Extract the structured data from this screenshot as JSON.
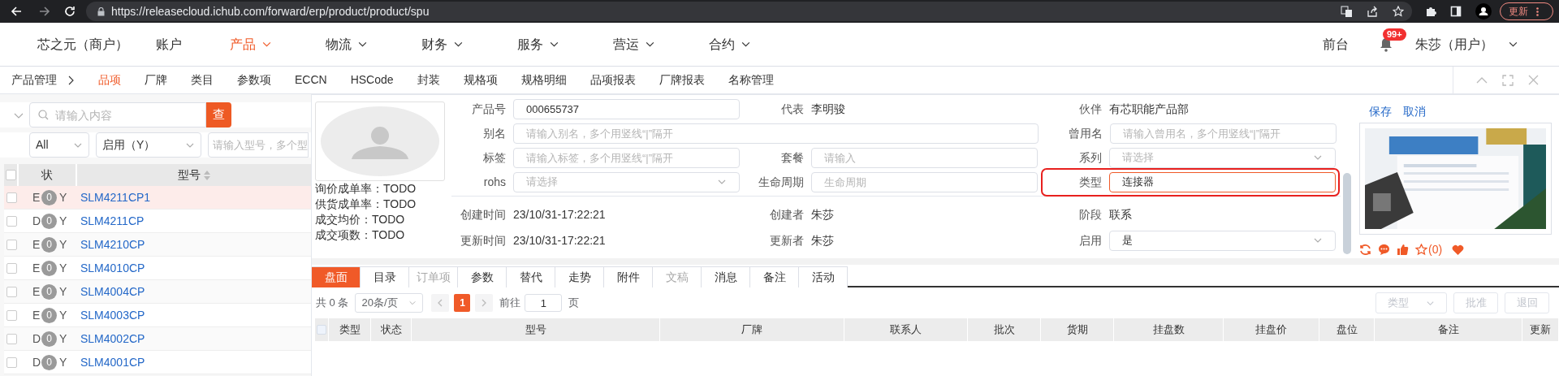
{
  "browser": {
    "url": "https://releasecloud.ichub.com/forward/erp/product/product/spu",
    "update_button": "更新"
  },
  "nav": {
    "brand": "芯之元（商户）",
    "items": [
      {
        "label": "账户",
        "dropdown": false,
        "selected": false
      },
      {
        "label": "产品",
        "dropdown": true,
        "selected": true
      },
      {
        "label": "物流",
        "dropdown": true,
        "selected": false
      },
      {
        "label": "财务",
        "dropdown": true,
        "selected": false
      },
      {
        "label": "服务",
        "dropdown": true,
        "selected": false
      },
      {
        "label": "营运",
        "dropdown": true,
        "selected": false
      },
      {
        "label": "合约",
        "dropdown": true,
        "selected": false
      }
    ],
    "front_desk": "前台",
    "notification_badge": "99+",
    "user": "朱莎（用户）"
  },
  "subnav": {
    "root": "产品管理",
    "items": [
      {
        "label": "品项",
        "selected": true
      },
      {
        "label": "厂牌",
        "selected": false
      },
      {
        "label": "类目",
        "selected": false
      },
      {
        "label": "参数项",
        "selected": false
      },
      {
        "label": "ECCN",
        "selected": false
      },
      {
        "label": "HSCode",
        "selected": false
      },
      {
        "label": "封装",
        "selected": false
      },
      {
        "label": "规格项",
        "selected": false
      },
      {
        "label": "规格明细",
        "selected": false
      },
      {
        "label": "品项报表",
        "selected": false
      },
      {
        "label": "厂牌报表",
        "selected": false
      },
      {
        "label": "名称管理",
        "selected": false
      }
    ]
  },
  "filter": {
    "search_placeholder": "请输入内容",
    "search_button": "查",
    "type_select": "All",
    "status_select": "启用（Y）",
    "model_placeholder": "请输入型号，多个型"
  },
  "list": {
    "columns": [
      "状",
      "型号"
    ],
    "select_all_checked": false,
    "rows": [
      {
        "status": "E",
        "count": "0",
        "flag": "Y",
        "model": "SLM4211CP1",
        "selected": true
      },
      {
        "status": "D",
        "count": "0",
        "flag": "Y",
        "model": "SLM4211CP",
        "selected": false
      },
      {
        "status": "E",
        "count": "0",
        "flag": "Y",
        "model": "SLM4210CP",
        "selected": false
      },
      {
        "status": "E",
        "count": "0",
        "flag": "Y",
        "model": "SLM4010CP",
        "selected": false
      },
      {
        "status": "E",
        "count": "0",
        "flag": "Y",
        "model": "SLM4004CP",
        "selected": false
      },
      {
        "status": "E",
        "count": "0",
        "flag": "Y",
        "model": "SLM4003CP",
        "selected": false
      },
      {
        "status": "D",
        "count": "0",
        "flag": "Y",
        "model": "SLM4002CP",
        "selected": false
      },
      {
        "status": "D",
        "count": "0",
        "flag": "Y",
        "model": "SLM4001CP",
        "selected": false
      }
    ]
  },
  "stats": [
    "询价成单率：TODO",
    "供货成单率：TODO",
    "成交均价：TODO",
    "成交项数：TODO"
  ],
  "form": {
    "top_rows": [
      [
        {
          "label": "产品号",
          "kind": "input",
          "value": "000655737",
          "highlighted": false
        },
        {
          "label": "代表",
          "kind": "text",
          "value": "李明骏"
        },
        {
          "label": "伙伴",
          "kind": "text",
          "value": "有芯职能产品部"
        }
      ],
      [
        {
          "label": "别名",
          "kind": "wide_input",
          "placeholder": "请输入别名，多个用竖线“|”隔开",
          "highlighted": false
        },
        {
          "label": "曾用名",
          "kind": "input",
          "placeholder": "请输入曾用名，多个用竖线“|”隔开",
          "highlighted": false
        }
      ],
      [
        {
          "label": "标签",
          "kind": "input",
          "placeholder": "请输入标签，多个用竖线“|”隔开",
          "highlighted": false
        },
        {
          "label": "套餐",
          "kind": "input",
          "placeholder": "请输入",
          "highlighted": false
        },
        {
          "label": "系列",
          "kind": "select",
          "placeholder": "请选择",
          "highlighted": false
        }
      ],
      [
        {
          "label": "rohs",
          "kind": "select",
          "placeholder": "请选择",
          "highlighted": false
        },
        {
          "label": "生命周期",
          "kind": "input",
          "placeholder": "生命周期",
          "highlighted": false
        },
        {
          "label": "类型",
          "kind": "input",
          "value": "连接器",
          "highlighted": true
        }
      ]
    ],
    "meta_rows": [
      [
        {
          "label": "创建时间",
          "kind": "text",
          "value": "23/10/31-17:22:21"
        },
        {
          "label": "创建者",
          "kind": "text",
          "value": "朱莎"
        },
        {
          "label": "阶段",
          "kind": "text",
          "value": "联系"
        }
      ],
      [
        {
          "label": "更新时间",
          "kind": "text",
          "value": "23/10/31-17:22:21"
        },
        {
          "label": "更新者",
          "kind": "text",
          "value": "朱莎"
        },
        {
          "label": "启用",
          "kind": "select",
          "value": "是"
        }
      ]
    ]
  },
  "actions": {
    "links": [
      "保存",
      "取消"
    ],
    "star_count": "(0)"
  },
  "tabs": [
    {
      "label": "盘面",
      "selected": true,
      "disabled": false
    },
    {
      "label": "目录",
      "selected": false,
      "disabled": false
    },
    {
      "label": "订单项",
      "selected": false,
      "disabled": true
    },
    {
      "label": "参数",
      "selected": false,
      "disabled": false
    },
    {
      "label": "替代",
      "selected": false,
      "disabled": false
    },
    {
      "label": "走势",
      "selected": false,
      "disabled": false
    },
    {
      "label": "附件",
      "selected": false,
      "disabled": false
    },
    {
      "label": "文稿",
      "selected": false,
      "disabled": true
    },
    {
      "label": "消息",
      "selected": false,
      "disabled": false
    },
    {
      "label": "备注",
      "selected": false,
      "disabled": false
    },
    {
      "label": "活动",
      "selected": false,
      "disabled": false
    }
  ],
  "pagination": {
    "total": "共 0 条",
    "page_size": "20条/页",
    "current_page": "1",
    "goto_label": "前往",
    "goto_value": "1",
    "page_unit": "页"
  },
  "table_tools": {
    "type_select": "类型",
    "buttons": [
      {
        "label": "批准",
        "disabled": true
      },
      {
        "label": "退回",
        "disabled": true
      }
    ]
  },
  "table": {
    "select_all_checked": false,
    "columns": [
      "类型",
      "状态",
      "型号",
      "厂牌",
      "联系人",
      "批次",
      "货期",
      "挂盘数",
      "挂盘价",
      "盘位",
      "备注",
      "更新"
    ]
  }
}
